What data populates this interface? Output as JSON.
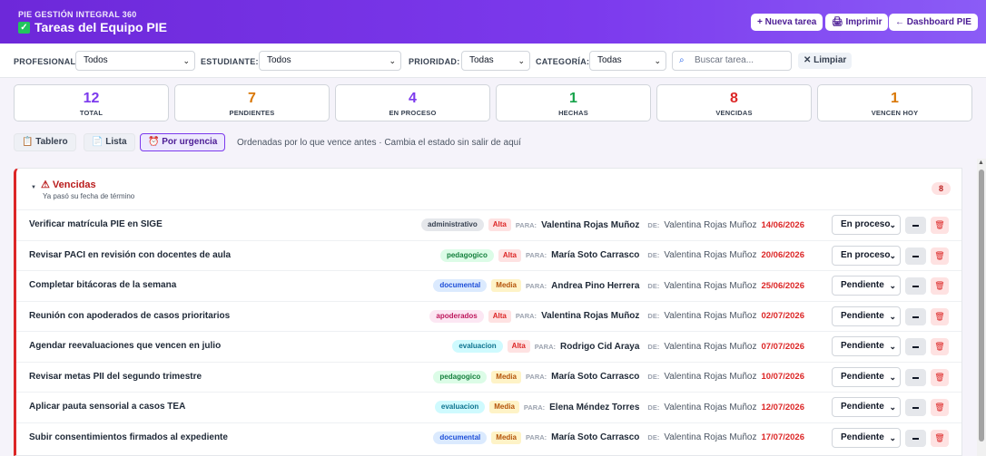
{
  "header": {
    "brand": "PIE GESTIÓN INTEGRAL 360",
    "title": "Tareas del Equipo PIE",
    "new_task": "+ Nueva tarea",
    "print": "🖨 Imprimir",
    "dashboard": "← Dashboard PIE"
  },
  "filters": {
    "profesional_label": "PROFESIONAL:",
    "profesional_value": "Todos",
    "estudiante_label": "ESTUDIANTE:",
    "estudiante_value": "Todos",
    "prioridad_label": "PRIORIDAD:",
    "prioridad_value": "Todas",
    "categoria_label": "CATEGORÍA:",
    "categoria_value": "Todas",
    "search_placeholder": "Buscar tarea...",
    "clear_label": "✕ Limpiar"
  },
  "stats": [
    {
      "value": "12",
      "label": "TOTAL",
      "color": "#7c3aed"
    },
    {
      "value": "7",
      "label": "PENDIENTES",
      "color": "#d97706"
    },
    {
      "value": "4",
      "label": "EN PROCESO",
      "color": "#7c3aed"
    },
    {
      "value": "1",
      "label": "HECHAS",
      "color": "#16a34a"
    },
    {
      "value": "8",
      "label": "VENCIDAS",
      "color": "#dc2626"
    },
    {
      "value": "1",
      "label": "VENCEN HOY",
      "color": "#d97706"
    }
  ],
  "views": {
    "board": "Tablero",
    "list": "Lista",
    "urgency": "Por urgencia",
    "hint": "Ordenadas por lo que vence antes · Cambia el estado sin salir de aquí"
  },
  "group": {
    "title": "⚠ Vencidas",
    "subtitle": "Ya pasó su fecha de término",
    "count": "8",
    "para_label": "PARA:",
    "de_label": "DE:"
  },
  "tasks": [
    {
      "title": "Verificar matrícula PIE en SIGE",
      "category": "administrativo",
      "priority": "Alta",
      "to": "Valentina Rojas Muñoz",
      "from": "Valentina Rojas Muñoz",
      "date": "14/06/2026",
      "status": "En proceso"
    },
    {
      "title": "Revisar PACI en revisión con docentes de aula",
      "category": "pedagogico",
      "priority": "Alta",
      "to": "María Soto Carrasco",
      "from": "Valentina Rojas Muñoz",
      "date": "20/06/2026",
      "status": "En proceso"
    },
    {
      "title": "Completar bitácoras de la semana",
      "category": "documental",
      "priority": "Media",
      "to": "Andrea Pino Herrera",
      "from": "Valentina Rojas Muñoz",
      "date": "25/06/2026",
      "status": "Pendiente"
    },
    {
      "title": "Reunión con apoderados de casos prioritarios",
      "category": "apoderados",
      "priority": "Alta",
      "to": "Valentina Rojas Muñoz",
      "from": "Valentina Rojas Muñoz",
      "date": "02/07/2026",
      "status": "Pendiente"
    },
    {
      "title": "Agendar reevaluaciones que vencen en julio",
      "category": "evaluacion",
      "priority": "Alta",
      "to": "Rodrigo Cid Araya",
      "from": "Valentina Rojas Muñoz",
      "date": "07/07/2026",
      "status": "Pendiente"
    },
    {
      "title": "Revisar metas PII del segundo trimestre",
      "category": "pedagogico",
      "priority": "Media",
      "to": "María Soto Carrasco",
      "from": "Valentina Rojas Muñoz",
      "date": "10/07/2026",
      "status": "Pendiente"
    },
    {
      "title": "Aplicar pauta sensorial a casos TEA",
      "category": "evaluacion",
      "priority": "Media",
      "to": "Elena Méndez Torres",
      "from": "Valentina Rojas Muñoz",
      "date": "12/07/2026",
      "status": "Pendiente"
    },
    {
      "title": "Subir consentimientos firmados al expediente",
      "category": "documental",
      "priority": "Media",
      "to": "María Soto Carrasco",
      "from": "Valentina Rojas Muñoz",
      "date": "17/07/2026",
      "status": "Pendiente"
    }
  ],
  "category_colors": {
    "administrativo": {
      "bg": "#e5e7eb",
      "fg": "#374151"
    },
    "pedagogico": {
      "bg": "#dcfce7",
      "fg": "#15803d"
    },
    "documental": {
      "bg": "#dbeafe",
      "fg": "#1d4ed8"
    },
    "apoderados": {
      "bg": "#fce7f3",
      "fg": "#be185d"
    },
    "evaluacion": {
      "bg": "#cffafe",
      "fg": "#0e7490"
    }
  },
  "priority_colors": {
    "Alta": {
      "bg": "#fee2e2",
      "fg": "#dc2626"
    },
    "Media": {
      "bg": "#fef3c7",
      "fg": "#b45309"
    }
  }
}
